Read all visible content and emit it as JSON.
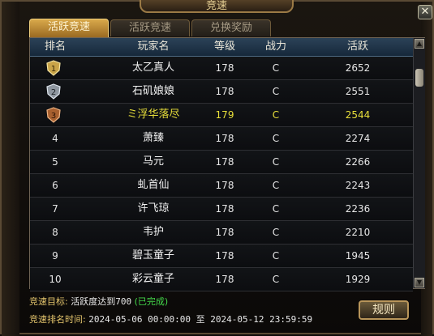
{
  "window": {
    "title": "竞速",
    "close_label": "✕"
  },
  "tabs": [
    {
      "label": "活跃竞速",
      "active": true
    },
    {
      "label": "活跃竞速",
      "active": false
    },
    {
      "label": "兑换奖励",
      "active": false
    }
  ],
  "table": {
    "headers": [
      "排名",
      "玩家名",
      "等级",
      "战力",
      "活跃"
    ],
    "rows": [
      {
        "rank": "1",
        "name": "太乙真人",
        "level": "178",
        "power": "C",
        "active": "2652",
        "medal": "gold"
      },
      {
        "rank": "2",
        "name": "石矶娘娘",
        "level": "178",
        "power": "C",
        "active": "2551",
        "medal": "silver"
      },
      {
        "rank": "3",
        "name": "ミ浮华落尽",
        "level": "179",
        "power": "C",
        "active": "2544",
        "medal": "bronze",
        "highlight": true
      },
      {
        "rank": "4",
        "name": "萧臻",
        "level": "178",
        "power": "C",
        "active": "2274"
      },
      {
        "rank": "5",
        "name": "马元",
        "level": "178",
        "power": "C",
        "active": "2266"
      },
      {
        "rank": "6",
        "name": "虬首仙",
        "level": "178",
        "power": "C",
        "active": "2243"
      },
      {
        "rank": "7",
        "name": "许飞琼",
        "level": "178",
        "power": "C",
        "active": "2236"
      },
      {
        "rank": "8",
        "name": "韦护",
        "level": "178",
        "power": "C",
        "active": "2210"
      },
      {
        "rank": "9",
        "name": "碧玉童子",
        "level": "178",
        "power": "C",
        "active": "1945"
      },
      {
        "rank": "10",
        "name": "彩云童子",
        "level": "178",
        "power": "C",
        "active": "1929"
      }
    ]
  },
  "footer": {
    "goal_label": "竞速目标:",
    "goal_value": "活跃度达到700",
    "goal_status": "(已完成)",
    "time_label": "竞速排名时间:",
    "time_value": "2024-05-06 00:00:00 至 2024-05-12 23:59:59"
  },
  "rules_button": "规则",
  "colors": {
    "accent_gold": "#d9a94b",
    "highlight_yellow": "#e8df3a",
    "done_green": "#43d84a",
    "header_blue": "#2b4258"
  }
}
